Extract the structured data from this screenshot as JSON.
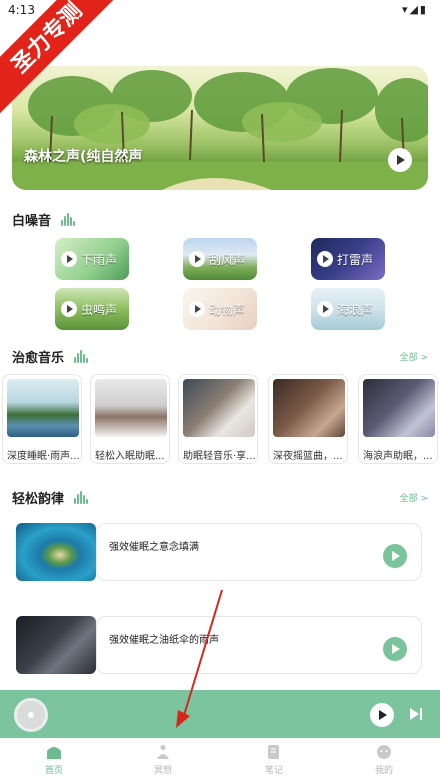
{
  "status_bar": {
    "time": "4:13",
    "icons": "▾◢▮"
  },
  "watermark": {
    "text": "圣力专测"
  },
  "banner": {
    "title": "森林之声(纯自然声"
  },
  "white_noise": {
    "title": "白噪音",
    "items": [
      {
        "label": "下雨声"
      },
      {
        "label": "刮风声"
      },
      {
        "label": "打雷声"
      },
      {
        "label": "虫鸣声"
      },
      {
        "label": "动物声"
      },
      {
        "label": "海浪声"
      }
    ]
  },
  "healing_music": {
    "title": "治愈音乐",
    "more": "全部 >",
    "items": [
      {
        "label": "深度睡眠·雨声..."
      },
      {
        "label": "轻松入眠助眠..."
      },
      {
        "label": "助眠轻音乐·享..."
      },
      {
        "label": "深夜摇篮曲，..."
      },
      {
        "label": "海浪声助眠，..."
      }
    ]
  },
  "relax_rhythm": {
    "title": "轻松韵律",
    "more": "全部 >",
    "items": [
      {
        "title": "强效催眠之意念填满"
      },
      {
        "title": "强效催眠之油纸伞的雨声"
      }
    ]
  },
  "tabs": [
    {
      "label": "首页",
      "icon": "home-icon",
      "active": true
    },
    {
      "label": "冥想",
      "icon": "meditation-icon",
      "active": false
    },
    {
      "label": "笔记",
      "icon": "notes-icon",
      "active": false
    },
    {
      "label": "我的",
      "icon": "profile-icon",
      "active": false
    }
  ],
  "colors": {
    "accent": "#6dbb91",
    "player_bar": "#7cc49d",
    "watermark": "#e2231a"
  }
}
